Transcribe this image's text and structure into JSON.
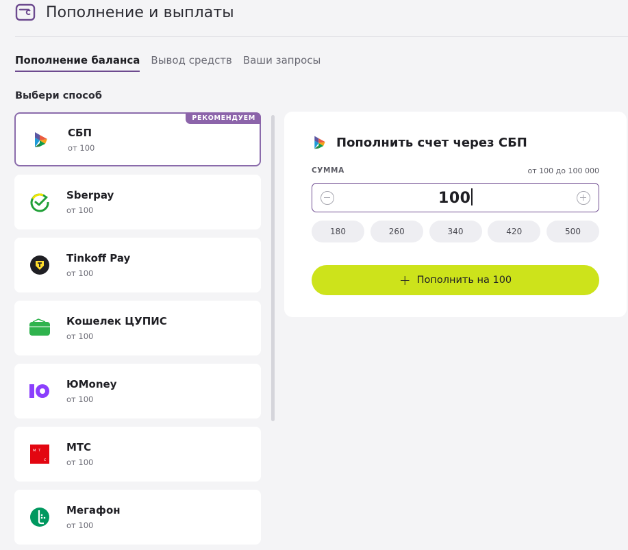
{
  "page": {
    "title": "Пополнение и выплаты",
    "icon": "wallet-icon"
  },
  "tabs": [
    {
      "label": "Пополнение баланса",
      "active": true
    },
    {
      "label": "Вывод средств",
      "active": false
    },
    {
      "label": "Ваши запросы",
      "active": false
    }
  ],
  "section_label": "Выбери способ",
  "methods": [
    {
      "name": "СБП",
      "min": "от 100",
      "badge": "РЕКОМЕНДУЕМ",
      "icon": "sbp-icon",
      "selected": true
    },
    {
      "name": "Sberpay",
      "min": "от 100",
      "icon": "sberpay-icon"
    },
    {
      "name": "Tinkoff Pay",
      "min": "от 100",
      "icon": "tinkoff-icon"
    },
    {
      "name": "Кошелек ЦУПИС",
      "min": "от 100",
      "icon": "cupis-wallet-icon"
    },
    {
      "name": "ЮMoney",
      "min": "от 100",
      "icon": "yoomoney-icon"
    },
    {
      "name": "МТС",
      "min": "от 100",
      "icon": "mts-icon"
    },
    {
      "name": "Мегафон",
      "min": "от 100",
      "icon": "megafon-icon"
    }
  ],
  "panel": {
    "title": "Пополнить счет через СБП",
    "amount_label": "СУММА",
    "amount_range": "от 100 до 100 000",
    "amount_value": "100",
    "presets": [
      "180",
      "260",
      "340",
      "420",
      "500"
    ],
    "submit_label": "Пополнить на 100"
  },
  "colors": {
    "accent": "#8c64aa",
    "submit": "#cde31b",
    "background": "#f4f4f6"
  }
}
